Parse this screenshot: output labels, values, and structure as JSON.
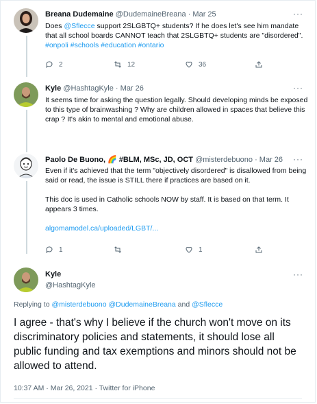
{
  "tweets": [
    {
      "author": "Breana Dudemaine",
      "handle": "@DudemaineBreana",
      "sep": "·",
      "date": "Mar 25",
      "more": "···",
      "body_parts": {
        "t1": "Does ",
        "m1": "@Sflecce",
        "t2": " support 2SLGBTQ+ students? If he does let's see him mandate that all school boards CANNOT teach that 2SLGBTQ+ students are \"disordered\".  ",
        "h1": "#onpoli",
        "sp1": " ",
        "h2": "#schools",
        "sp2": " ",
        "h3": "#education",
        "sp3": " ",
        "h4": "#ontario"
      },
      "replies": "2",
      "retweets": "12",
      "likes": "36"
    },
    {
      "author": "Kyle",
      "handle": "@HashtagKyle",
      "sep": "·",
      "date": "Mar 26",
      "more": "···",
      "body": "It seems time for asking the question legally. Should developing minds be exposed to this type of brainwashing ? Why are children allowed in spaces that believe this crap ? It's akin to mental and emotional abuse."
    },
    {
      "author": "Paolo De Buono, 🌈 #BLM, MSc, JD, OCT",
      "handle": "@misterdebuono",
      "sep": "·",
      "date": "Mar 26",
      "more": "···",
      "para1": "Even if it's achieved that the term \"objectively disordered\" is disallowed from being said or read, the issue is STILL there if practices are based on it.",
      "para2": "This doc is used in Catholic schools NOW by staff. It is based on that term. It appears 3 times.",
      "link": "algomamodel.ca/uploaded/LGBT/...",
      "replies": "1",
      "likes": "1"
    }
  ],
  "main": {
    "author": "Kyle",
    "handle": "@HashtagKyle",
    "more": "···",
    "replying_to": "Replying to ",
    "reply_m1": "@misterdebuono",
    "reply_m2": "@DudemaineBreana",
    "reply_and": " and ",
    "reply_m3": "@Sflecce",
    "body": "I agree - that's why I believe if the church won't move on its discriminatory policies and statements, it should lose all public funding and tax exemptions and minors should not be allowed to attend.",
    "timestamp": "10:37 AM · Mar 26, 2021 · Twitter for iPhone"
  },
  "icons": {
    "reply": "reply-icon",
    "retweet": "retweet-icon",
    "like": "heart-icon",
    "share": "share-icon"
  },
  "colors": {
    "link": "#1d9bf0",
    "muted": "#536471",
    "thread_line": "#cfd9de"
  }
}
